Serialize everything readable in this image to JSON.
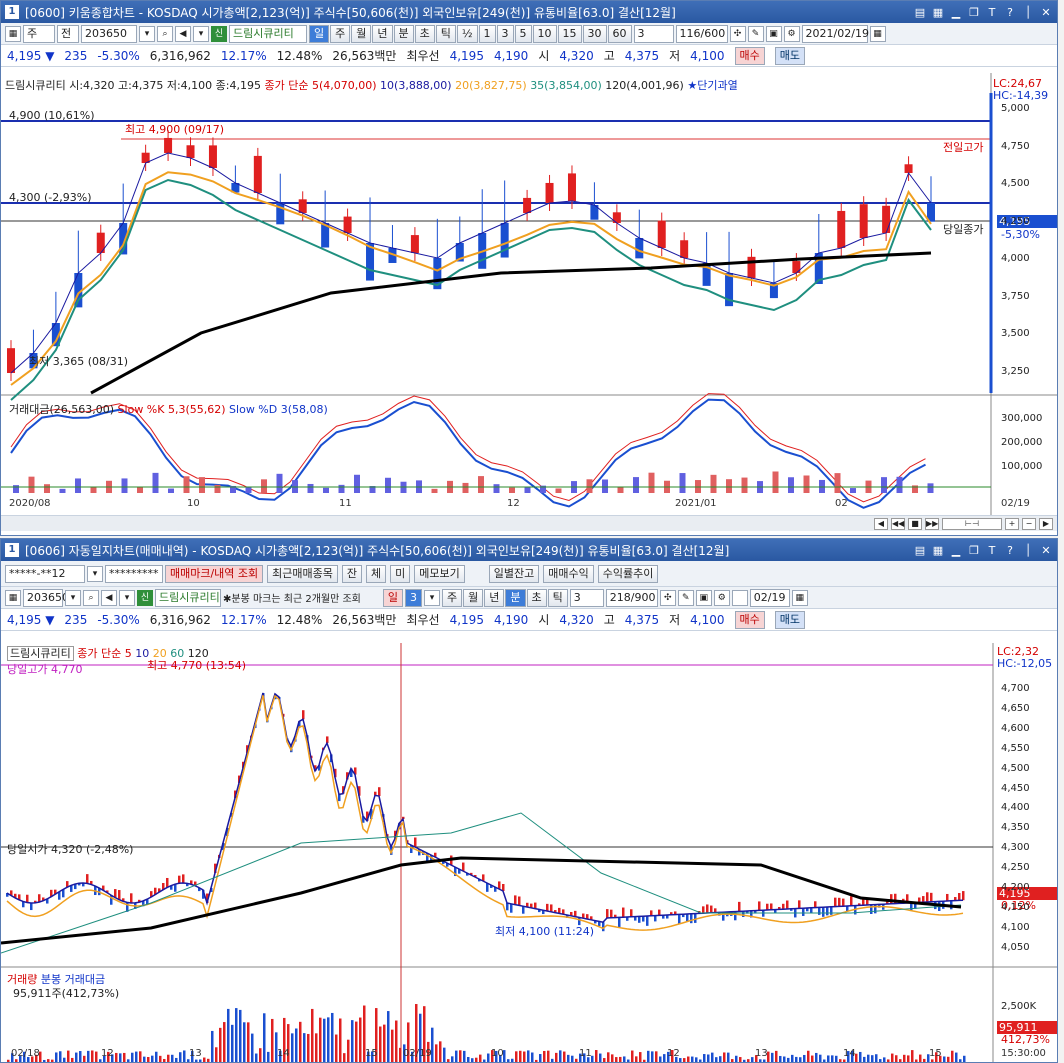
{
  "top": {
    "title": "[0600] 키움종합차트 - KOSDAQ 시가총액[2,123(억)] 주식수[50,606(천)] 외국인보유[249(천)] 유통비율[63.0] 결산[12월]",
    "window_num": "1",
    "toolbar": {
      "type1": "주",
      "type2": "전",
      "code": "203650",
      "badge": "신",
      "name": "드림시큐리티",
      "periods": [
        "일",
        "주",
        "월",
        "년",
        "분",
        "초",
        "틱",
        "½",
        "1",
        "3",
        "5",
        "10",
        "15",
        "30",
        "60"
      ],
      "active_period": "일",
      "count_value": "3",
      "page": "116/600",
      "date": "2021/02/19"
    },
    "price_line": {
      "price": "4,195",
      "arrow": "▼",
      "change": "235",
      "pct": "-5.30%",
      "volume": "6,316,962",
      "pct2": "12.17%",
      "pct3": "12.48%",
      "amount": "26,563백만",
      "best_label": "최우선",
      "best_ask": "4,195",
      "best_bid": "4,190",
      "open_label": "시",
      "open": "4,320",
      "high_label": "고",
      "high": "4,375",
      "low_label": "저",
      "low": "4,100",
      "buy": "매수",
      "sell": "매도"
    },
    "legend_main": {
      "ohlc": "드림시큐리티 시:4,320 고:4,375 저:4,100 종:4,195",
      "ma_title": "종가 단순 5(4,070,00)",
      "ma10": "10(3,888,00)",
      "ma20": "20(3,827,75)",
      "ma35": "35(3,854,00)",
      "ma120": "120(4,001,96)",
      "star": "★단기과열"
    },
    "right_labels": {
      "lc": "LC:24,67",
      "hc": "HC:-14,39",
      "cur": "4,195",
      "cur_pct": "-5,30%"
    },
    "annotations": {
      "h_line1": "4,900 (10,61%)",
      "high_mark": "최고 4,900 (09/17)",
      "h_line2": "4,300 (-2,93%)",
      "low_mark": "최저 3,365 (08/31)",
      "prev_high": "전일고가",
      "today_close": "당일종가"
    },
    "y_axis": [
      "5,000",
      "4,750",
      "4,500",
      "4,250",
      "4,000",
      "3,750",
      "3,500",
      "3,250"
    ],
    "legend_sub": {
      "amount": "거래대금(26,563,00)",
      "k": "Slow %K 5,3(55,62)",
      "d": "Slow %D 3(58,08)"
    },
    "y_axis_sub": [
      "300,000",
      "200,000",
      "100,000"
    ],
    "x_axis": [
      "2020/08",
      "10",
      "11",
      "12",
      "2021/01",
      "02",
      "02/19"
    ]
  },
  "bottom": {
    "title": "[0606] 자동일지차트(매매내역) - KOSDAQ 시가총액[2,123(억)] 주식수[50,606(천)] 외국인보유[249(천)] 유통비율[63.0] 결산[12월]",
    "window_num": "1",
    "account": "*****-**12",
    "password": "*********",
    "buttons": [
      "매매마크/내역 조회",
      "최근매매종목",
      "잔",
      "체",
      "미",
      "메모보기",
      "일별잔고",
      "매매수익",
      "수익률추이"
    ],
    "toolbar": {
      "code": "203650",
      "badge": "신",
      "name": "드림시큐리티",
      "note": "분봉 마크는 최근 2개월만 조회",
      "period_day": "일",
      "period_val": "3",
      "periods": [
        "주",
        "월",
        "년",
        "분",
        "초",
        "틱"
      ],
      "active_period": "분",
      "count_value": "3",
      "page": "218/900",
      "date": "02/19"
    },
    "legend_main": {
      "name": "드림시큐리티",
      "ma": "종가 단순 5",
      "ma10": "10",
      "ma20": "20",
      "ma60": "60",
      "ma120": "120"
    },
    "right_labels": {
      "lc": "LC:2,32",
      "hc": "HC:-12,05",
      "cur": "4,195",
      "cur_pct": "0,12%"
    },
    "annotations": {
      "prev_high": "당일고가 4,770",
      "high_mark": "최고 4,770 (13:54)",
      "open_line": "당일시가 4,320 (-2,48%)",
      "low_mark": "최저 4,100 (11:24)"
    },
    "y_axis": [
      "4,700",
      "4,650",
      "4,600",
      "4,550",
      "4,500",
      "4,450",
      "4,400",
      "4,350",
      "4,300",
      "4,250",
      "4,200",
      "4,150",
      "4,100",
      "4,050"
    ],
    "legend_sub": {
      "vol": "거래량",
      "amt": "분봉 거래대금",
      "val": "95,911주(412,73%)"
    },
    "y_axis_sub": [
      "2,500K"
    ],
    "sub_right": {
      "val": "95,911",
      "pct": "412,73%"
    },
    "x_axis": [
      "02/18",
      "12",
      "13",
      "14",
      "15",
      "02/19",
      "10",
      "11",
      "12",
      "13",
      "14",
      "15",
      "15:30:00"
    ]
  },
  "colors": {
    "up": "#e02020",
    "down": "#1a4fd0",
    "ma5": "#1a1aa0",
    "ma20": "#f0a020",
    "ma60": "#1f8f7f",
    "ma120": "#000000",
    "title_blue": "#2a58a2"
  }
}
